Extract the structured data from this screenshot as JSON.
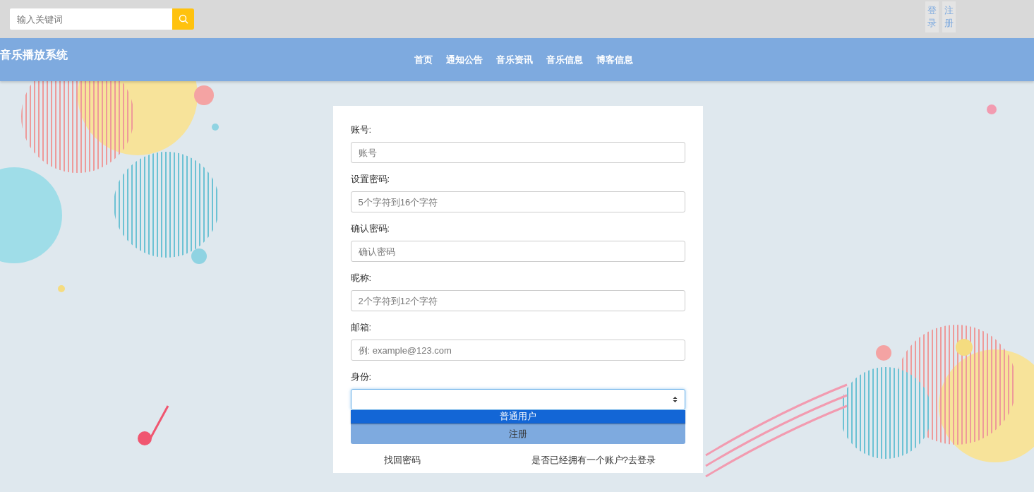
{
  "search": {
    "placeholder": "输入关键词"
  },
  "auth_links": [
    {
      "label": "登录"
    },
    {
      "label": "注册"
    }
  ],
  "site_title": "音乐播放系统",
  "nav": [
    {
      "label": "首页"
    },
    {
      "label": "通知公告"
    },
    {
      "label": "音乐资讯"
    },
    {
      "label": "音乐信息"
    },
    {
      "label": "博客信息"
    }
  ],
  "form": {
    "fields": [
      {
        "kind": "input",
        "label": "账号:",
        "placeholder": "账号"
      },
      {
        "kind": "input",
        "label": "设置密码:",
        "placeholder": "5个字符到16个字符"
      },
      {
        "kind": "input",
        "label": "确认密码:",
        "placeholder": "确认密码"
      },
      {
        "kind": "input",
        "label": "昵称:",
        "placeholder": "2个字符到12个字符"
      },
      {
        "kind": "input",
        "label": "邮箱:",
        "placeholder": "例: example@123.com"
      },
      {
        "kind": "select",
        "label": "身份:",
        "expanded": true,
        "options": [
          {
            "label": "普通用户",
            "selected": true
          }
        ]
      }
    ],
    "submit": "注册",
    "links": [
      "找回密码",
      "是否已经拥有一个账户?去登录"
    ]
  }
}
